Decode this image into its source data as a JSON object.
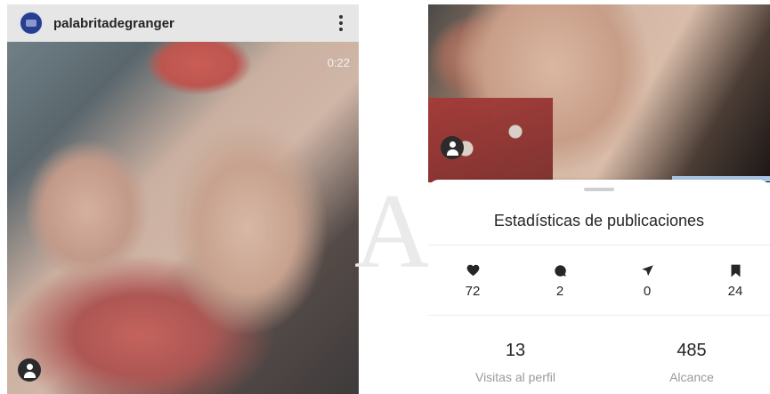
{
  "left_post": {
    "username": "palabritadegranger",
    "video_timer": "0:22",
    "icons": [
      "avatar",
      "more-vertical-icon",
      "user-tag-icon"
    ]
  },
  "watermark": "A",
  "right_post": {
    "sheet_title": "Estadísticas de publicaciones",
    "interactions": [
      {
        "icon": "heart-icon",
        "value": "72"
      },
      {
        "icon": "comment-icon",
        "value": "2"
      },
      {
        "icon": "send-icon",
        "value": "0"
      },
      {
        "icon": "bookmark-icon",
        "value": "24"
      }
    ],
    "profile_visits": {
      "value": "13",
      "label": "Visitas al perfil"
    },
    "reach": {
      "value": "485",
      "label": "Alcance"
    }
  },
  "colors": {
    "avatar_blue": "#283f8f",
    "icon_dark": "#262626",
    "label_gray": "#9a9a9a"
  }
}
